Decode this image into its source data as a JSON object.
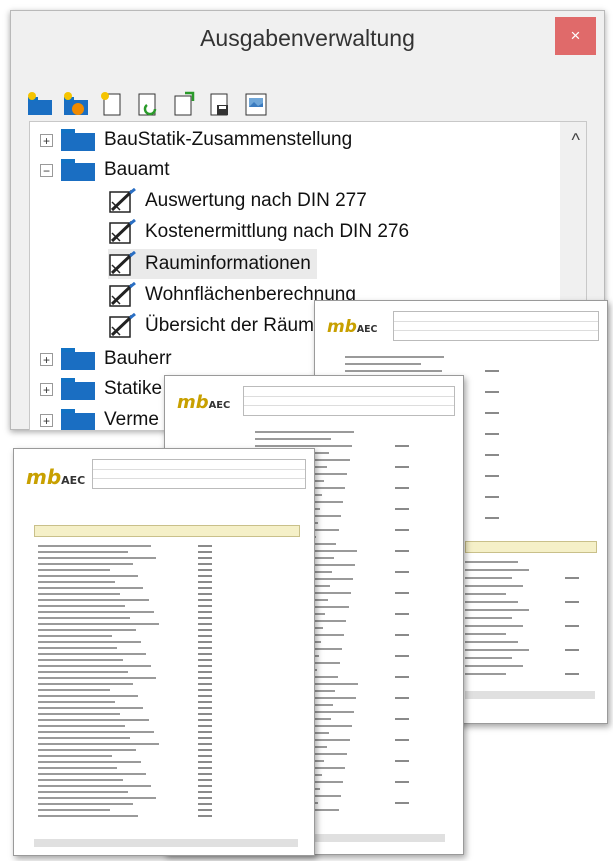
{
  "window": {
    "title": "Ausgabenverwaltung",
    "close_label": "×"
  },
  "toolbar": {
    "icons": [
      "new-folder-icon",
      "folder-settings-icon",
      "new-document-icon",
      "refresh-document-icon",
      "export-document-icon",
      "save-document-icon",
      "document-image-icon"
    ]
  },
  "tree": {
    "items": [
      {
        "label": "BauStatik-Zusammenstellung",
        "expander": "+"
      },
      {
        "label": "Bauamt",
        "expander": "−"
      },
      {
        "label": "Auswertung nach DIN 277"
      },
      {
        "label": "Kostenermittlung nach DIN 276"
      },
      {
        "label": "Rauminformationen"
      },
      {
        "label": "Wohnflächenberechnung"
      },
      {
        "label": "Übersicht der Räum"
      },
      {
        "label": "Bauherr",
        "expander": "+"
      },
      {
        "label": "Statike",
        "expander": "+"
      },
      {
        "label": "Verme",
        "expander": "+"
      }
    ],
    "scroll_up": "^"
  },
  "documents": {
    "logo_mb": "mb",
    "logo_aec": "AEC"
  }
}
